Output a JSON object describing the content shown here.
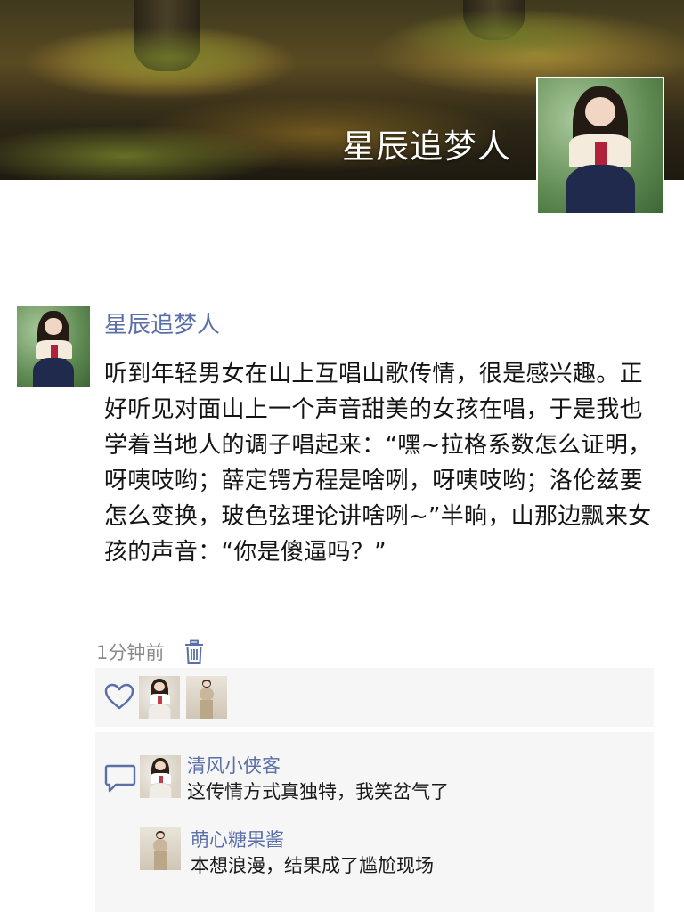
{
  "cover": {
    "title": "星辰追梦人"
  },
  "post": {
    "author": "星辰追梦人",
    "content": "听到年轻男女在山上互唱山歌传情，很是感兴趣。正好听见对面山上一个声音甜美的女孩在唱，于是我也学着当地人的调子唱起来：“嘿~拉格系数怎么证明，呀咦吱哟；薛定锷方程是啥咧，呀咦吱哟；洛伦兹要怎么变换，玻色弦理论讲啥咧~”半晌，山那边飘来女孩的声音：“你是傻逼吗？”",
    "time": "1分钟前"
  },
  "likes": {
    "icon": "heart-icon",
    "avatars": [
      "hanbok-girl-white",
      "beige-outfit-girl"
    ]
  },
  "comments": [
    {
      "name": "清风小侠客",
      "text": "这传情方式真独特，我笑岔气了"
    },
    {
      "name": "萌心糖果酱",
      "text": "本想浪漫，结果成了尴尬现场"
    }
  ],
  "colors": {
    "link": "#5b6fa8",
    "panel": "#f6f6f6",
    "meta": "#8a8a8a"
  }
}
